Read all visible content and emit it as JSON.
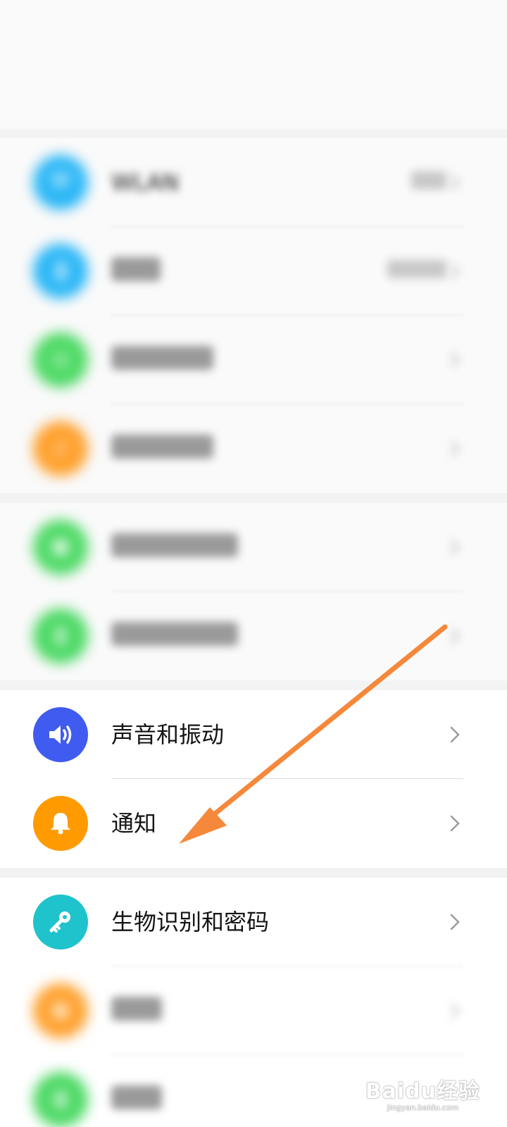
{
  "status_bar": {
    "left_text": "",
    "right_text": ""
  },
  "header": {
    "title": ""
  },
  "groups": [
    {
      "items": [
        {
          "label": "WLAN",
          "value": "",
          "icon": "wifi-icon",
          "color": "#29b6f6"
        },
        {
          "label": "",
          "value": "",
          "icon": "bluetooth-icon",
          "color": "#29b6f6"
        },
        {
          "label": "",
          "value": "",
          "icon": "mobile-network-icon",
          "color": "#4cd964"
        },
        {
          "label": "",
          "value": "",
          "icon": "link-icon",
          "color": "#ffa12e"
        }
      ]
    },
    {
      "items": [
        {
          "label": "",
          "value": "",
          "icon": "home-screen-icon",
          "color": "#4cd964"
        },
        {
          "label": "",
          "value": "",
          "icon": "display-icon",
          "color": "#4cd964"
        }
      ]
    },
    {
      "items": [
        {
          "label": "声音和振动",
          "icon": "speaker-icon",
          "color": "#3f5bf0"
        },
        {
          "label": "通知",
          "icon": "bell-icon",
          "color": "#ff9a00"
        }
      ]
    },
    {
      "items": [
        {
          "label": "生物识别和密码",
          "icon": "key-icon",
          "color": "#1fc3cc"
        },
        {
          "label": "",
          "icon": "apps-icon",
          "color": "#ffa12e"
        },
        {
          "label": "",
          "icon": "battery-icon",
          "color": "#4cd964"
        }
      ]
    }
  ],
  "annotation": {
    "arrow_color": "#f5883a"
  },
  "watermark": {
    "logo_text": "Baidu经验",
    "url_text": "jingyan.baidu.com"
  }
}
